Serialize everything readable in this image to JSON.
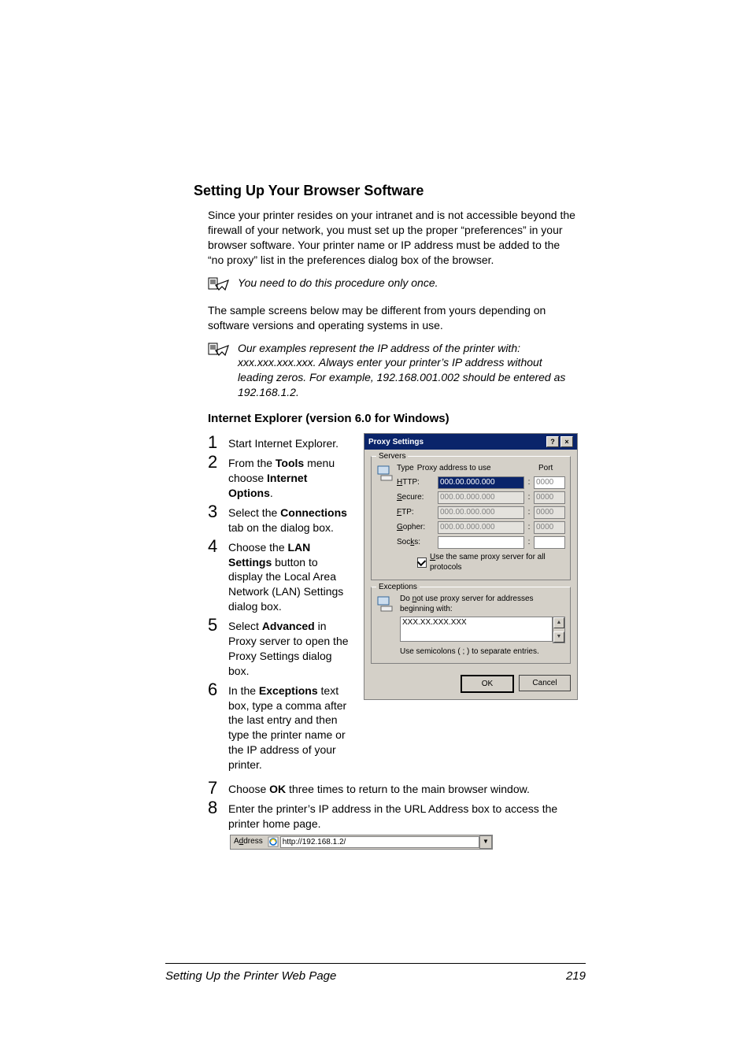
{
  "heading": "Setting Up Your Browser Software",
  "intro_para": "Since your printer resides on your intranet and is not accessible beyond the firewall of your network, you must set up the proper “preferences” in your browser software. Your printer name or IP address must be added to the “no proxy” list in the preferences dialog box of the browser.",
  "note1": "You need to do this procedure only once.",
  "sample_para": "The sample screens below may be different from yours depending on software versions and operating systems in use.",
  "note2": "Our examples represent the IP address of the printer with: xxx.xxx.xxx.xxx. Always enter your printer’s IP address without leading zeros. For example, 192.168.001.002 should be entered as 192.168.1.2.",
  "subheading": "Internet Explorer (version 6.0 for Windows)",
  "steps": {
    "s1": "Start Internet Explorer.",
    "s2_pre": "From the ",
    "s2_b1": "Tools",
    "s2_mid": " menu choose ",
    "s2_b2": "Internet Options",
    "s2_post": ".",
    "s3_pre": "Select the ",
    "s3_b": "Connections",
    "s3_post": " tab on the dialog box.",
    "s4_pre": "Choose the ",
    "s4_b": "LAN Settings",
    "s4_post": " button to display the Local Area Network (LAN) Settings dialog box.",
    "s5_pre": "Select ",
    "s5_b": "Advanced",
    "s5_post": " in Proxy server to open the Proxy Settings dialog box.",
    "s6_pre": "In the ",
    "s6_b": "Exceptions",
    "s6_post": " text box, type a comma after the last entry and then type the printer name or the IP address of your printer.",
    "s7_pre": "Choose ",
    "s7_b": "OK",
    "s7_post": " three times to return to the main browser window.",
    "s8": "Enter the printer’s IP address in the URL Address box to access the printer home page."
  },
  "dialog": {
    "title": "Proxy Settings",
    "servers_legend": "Servers",
    "type_label": "Type",
    "addr_label": "Proxy address to use",
    "port_label": "Port",
    "rows": {
      "http_label": "HTTP:",
      "secure_label": "Secure:",
      "ftp_label": "FTP:",
      "gopher_label": "Gopher:",
      "socks_label": "Socks:"
    },
    "addr_placeholder": "000.00.000.000",
    "port_placeholder": "0000",
    "same_proxy_label": "Use the same proxy server for all protocols",
    "exceptions_legend": "Exceptions",
    "exc_hint": "Do not use proxy server for addresses beginning with:",
    "exc_value": "XXX.XX.XXX.XXX",
    "exc_semi": "Use semicolons ( ; ) to separate entries.",
    "ok": "OK",
    "cancel": "Cancel"
  },
  "addrbar": {
    "label": "Address",
    "url": "http://192.168.1.2/"
  },
  "footer_left": "Setting Up the Printer Web Page",
  "footer_right": "219"
}
